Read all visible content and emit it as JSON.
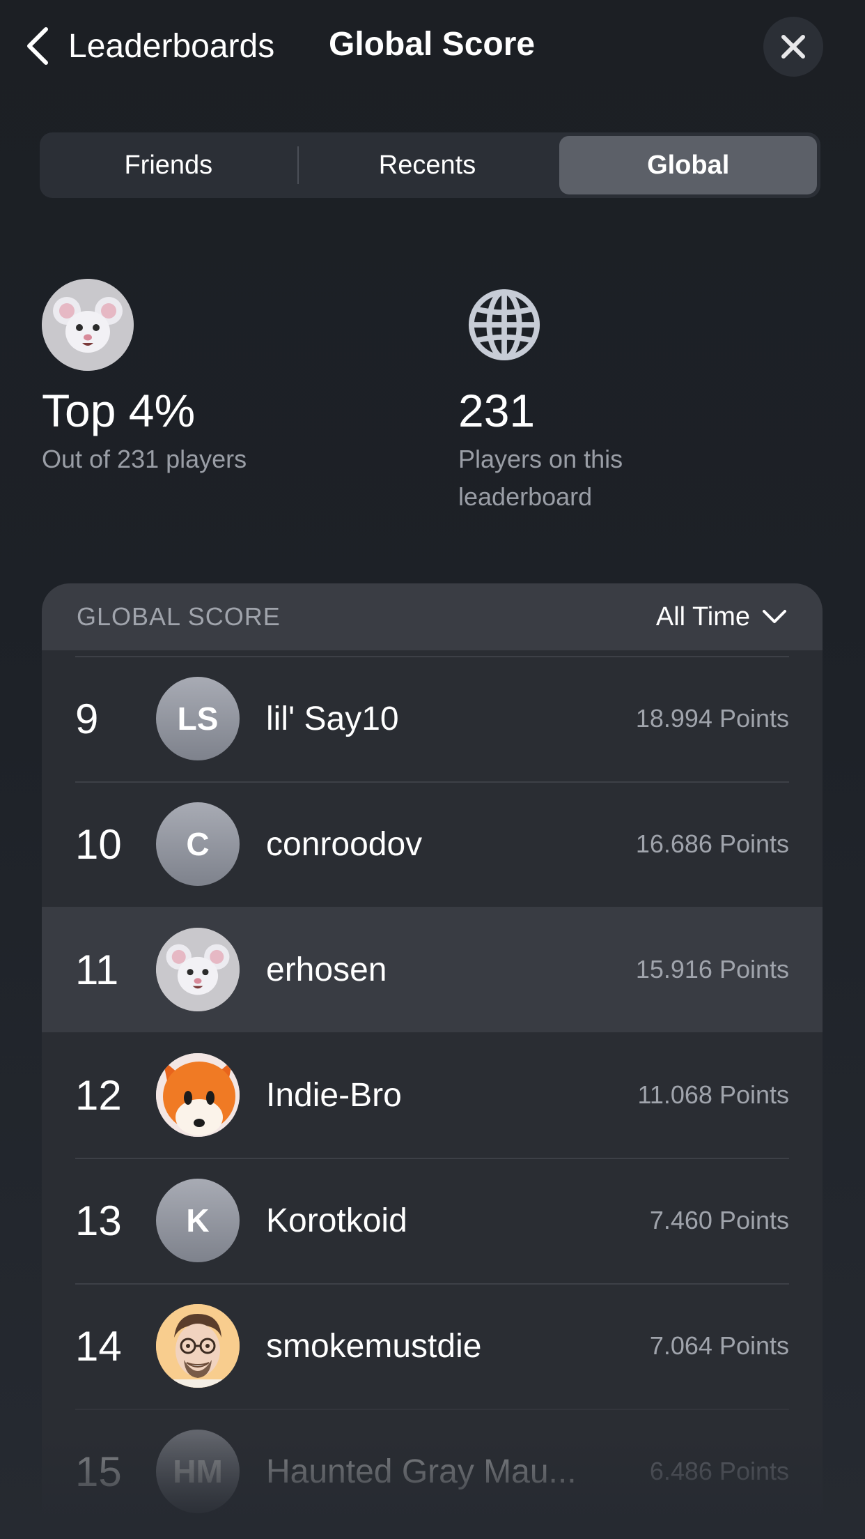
{
  "header": {
    "back_label": "Leaderboards",
    "title": "Global Score"
  },
  "tabs": [
    {
      "label": "Friends",
      "active": false
    },
    {
      "label": "Recents",
      "active": false
    },
    {
      "label": "Global",
      "active": true
    }
  ],
  "stats": {
    "rank_value": "Top 4%",
    "rank_sub": "Out of 231 players",
    "players_value": "231",
    "players_sub": "Players on this leaderboard"
  },
  "board": {
    "title": "GLOBAL SCORE",
    "period": "All Time",
    "rows": [
      {
        "rank": "9",
        "initials": "LS",
        "name": "lil' Say10",
        "points": "18.994 Points",
        "avatar": "initials"
      },
      {
        "rank": "10",
        "initials": "C",
        "name": "conroodov",
        "points": "16.686 Points",
        "avatar": "initials"
      },
      {
        "rank": "11",
        "initials": "",
        "name": "erhosen",
        "points": "15.916 Points",
        "avatar": "mouse-memoji"
      },
      {
        "rank": "12",
        "initials": "",
        "name": "Indie-Bro",
        "points": "11.068 Points",
        "avatar": "fox-memoji"
      },
      {
        "rank": "13",
        "initials": "K",
        "name": "Korotkoid",
        "points": "7.460 Points",
        "avatar": "initials"
      },
      {
        "rank": "14",
        "initials": "",
        "name": "smokemustdie",
        "points": "7.064 Points",
        "avatar": "man-memoji"
      },
      {
        "rank": "15",
        "initials": "HM",
        "name": "Haunted Gray Mau...",
        "points": "6.486 Points",
        "avatar": "initials"
      }
    ]
  },
  "colors": {
    "background": "#1d2127",
    "segmented_bg": "#2b2f36",
    "segment_active": "#5c6068",
    "board_bg": "#2a2d33",
    "row_highlight": "#393c43",
    "secondary_text": "#a0a4ac"
  }
}
